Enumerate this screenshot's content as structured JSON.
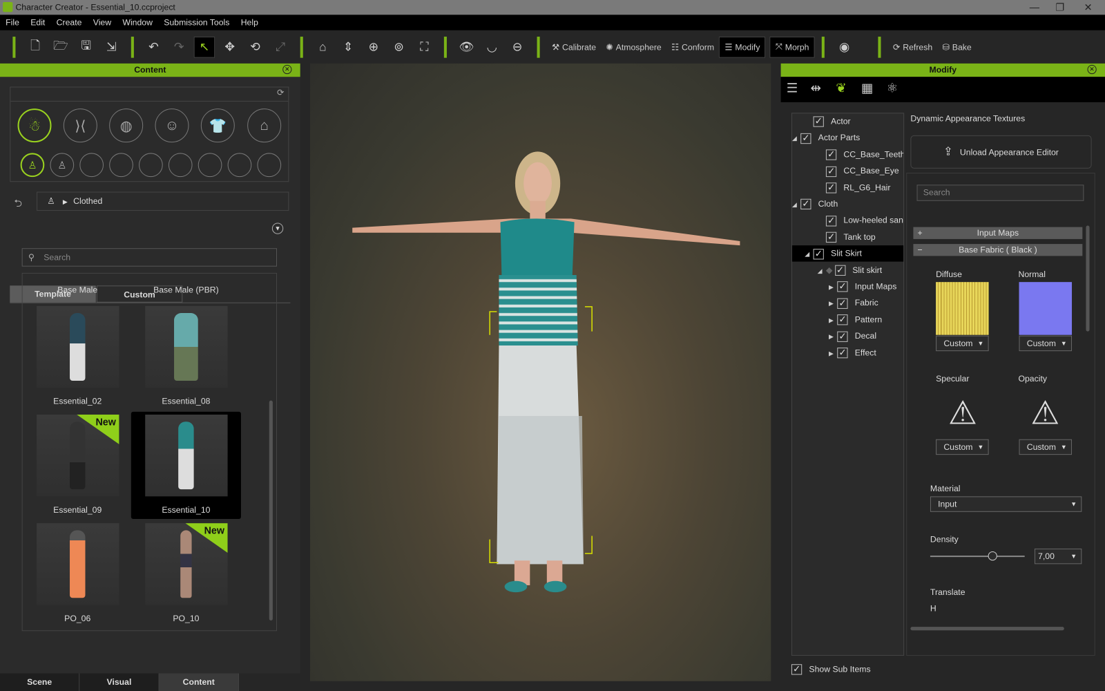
{
  "window": {
    "title": "Character Creator - Essential_10.ccproject"
  },
  "menu": [
    "File",
    "Edit",
    "Create",
    "View",
    "Window",
    "Submission Tools",
    "Help"
  ],
  "toolbar": {
    "calibrate": "Calibrate",
    "atmosphere": "Atmosphere",
    "conform": "Conform",
    "modify": "Modify",
    "morph": "Morph",
    "refresh": "Refresh",
    "bake": "Bake"
  },
  "content": {
    "title": "Content",
    "breadcrumb": "Clothed",
    "tabs": [
      "Template",
      "Custom"
    ],
    "search_placeholder": "Search",
    "items": [
      {
        "label": "Base Male"
      },
      {
        "label": "Base Male (PBR)"
      },
      {
        "label": "Essential_02"
      },
      {
        "label": "Essential_08"
      },
      {
        "label": "Essential_09",
        "badge": "New"
      },
      {
        "label": "Essential_10",
        "selected": true
      },
      {
        "label": "PO_06"
      },
      {
        "label": "PO_10",
        "badge": "New"
      }
    ],
    "bottom_tabs": [
      "Scene",
      "Visual",
      "Content"
    ],
    "active_bottom_tab": "Content"
  },
  "modify": {
    "title": "Modify",
    "tree": [
      {
        "label": "Actor"
      },
      {
        "label": "Actor Parts"
      },
      {
        "label": "CC_Base_Teeth"
      },
      {
        "label": "CC_Base_Eye"
      },
      {
        "label": "RL_G6_Hair"
      },
      {
        "label": "Cloth"
      },
      {
        "label": "Low-heeled sandals"
      },
      {
        "label": "Tank top"
      },
      {
        "label": "Slit Skirt",
        "selected": true
      },
      {
        "label": "Slit skirt"
      },
      {
        "label": "Input Maps"
      },
      {
        "label": "Fabric"
      },
      {
        "label": "Pattern"
      },
      {
        "label": "Decal"
      },
      {
        "label": "Effect"
      }
    ],
    "show_sub_items": "Show Sub Items",
    "section_title": "Dynamic Appearance Textures",
    "unload_button": "Unload Appearance Editor",
    "search_placeholder": "Search",
    "input_maps": "Input Maps",
    "base_fabric": "Base Fabric ( Black )",
    "textures": [
      {
        "label": "Diffuse",
        "value": "Custom",
        "color": "#e8d65a"
      },
      {
        "label": "Normal",
        "value": "Custom",
        "color": "#7a78f0"
      },
      {
        "label": "Specular",
        "value": "Custom"
      },
      {
        "label": "Opacity",
        "value": "Custom"
      }
    ],
    "material_label": "Material",
    "material_value": "Input",
    "density_label": "Density",
    "density_value": "7,00",
    "translate_label": "Translate",
    "translate_h": "H"
  },
  "accent": "#7ab317"
}
